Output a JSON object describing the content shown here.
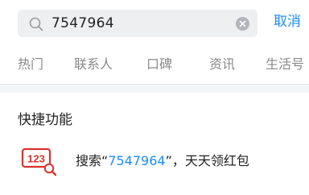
{
  "search": {
    "query": "7547964",
    "cancel_label": "取消"
  },
  "tabs": [
    {
      "label": "热门"
    },
    {
      "label": "联系人"
    },
    {
      "label": "口碑"
    },
    {
      "label": "资讯"
    },
    {
      "label": "生活号"
    }
  ],
  "quick_functions": {
    "title": "快捷功能",
    "items": [
      {
        "icon": "number-search-icon",
        "icon_text": "123",
        "prefix": "搜索“",
        "keyword": "7547964",
        "suffix": "”，天天领红包"
      }
    ]
  },
  "colors": {
    "accent": "#1a8cff",
    "icon_red": "#d9332f",
    "search_bg": "#eeeff1",
    "tab_text": "#8a8a8a"
  }
}
